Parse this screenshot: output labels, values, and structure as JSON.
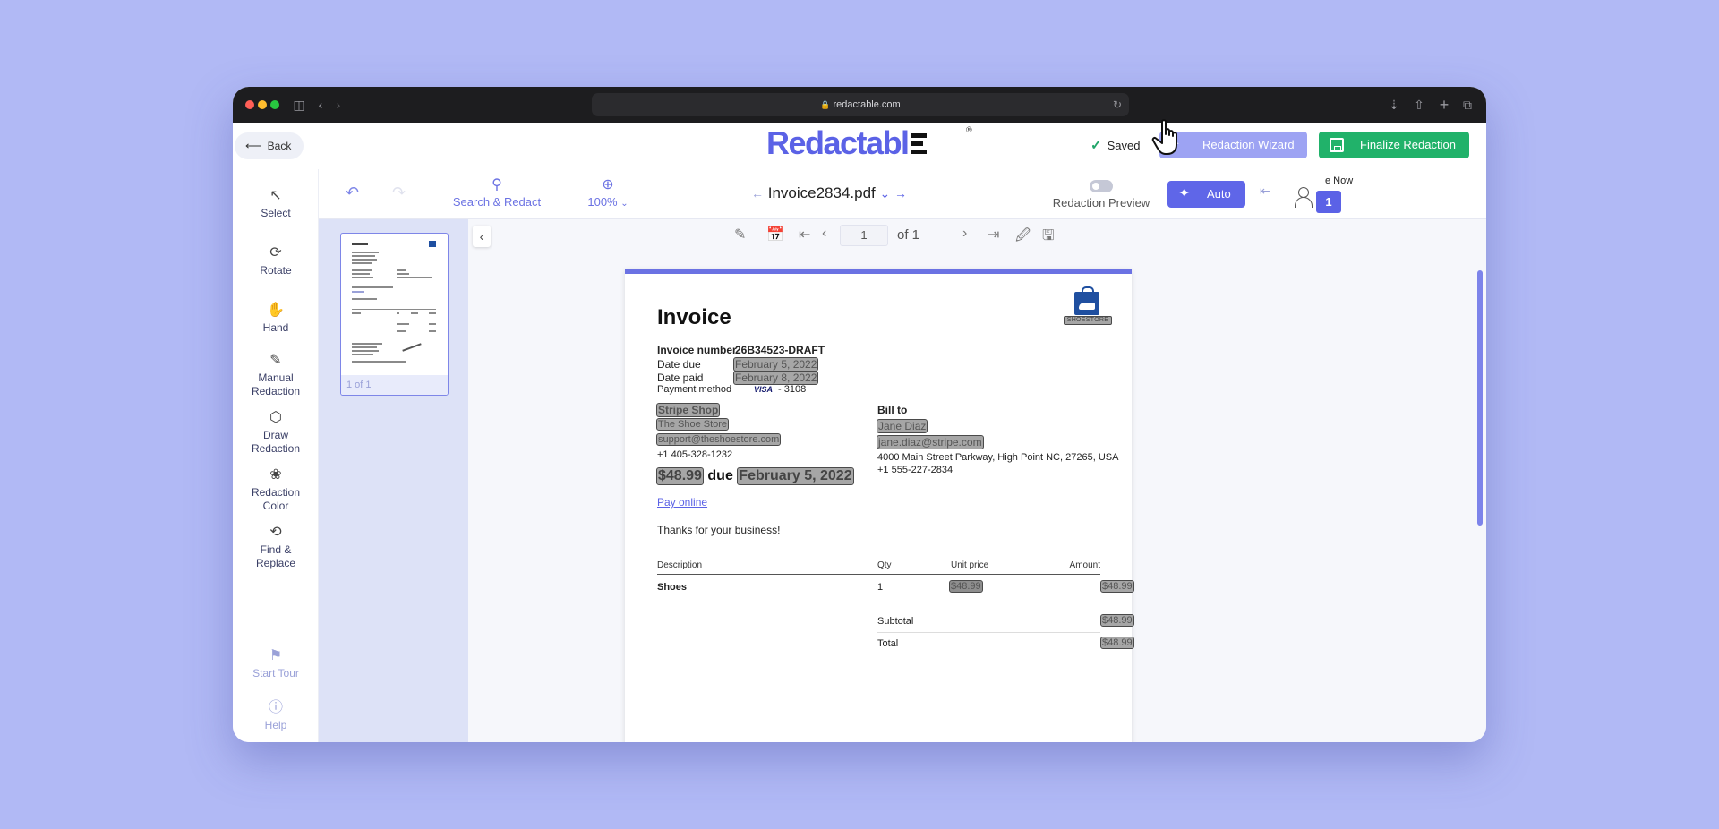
{
  "browser": {
    "url": "redactable.com"
  },
  "header": {
    "back_label": "Back",
    "logo_text": "Redactabl",
    "logo_registered": "®",
    "saved_label": "Saved",
    "wizard_label": "Redaction Wizard",
    "finalize_label": "Finalize Redaction",
    "cta_partial": "e Now"
  },
  "tools": {
    "select": "Select",
    "rotate": "Rotate",
    "hand": "Hand",
    "manual_1": "Manual",
    "manual_2": "Redaction",
    "draw_1": "Draw",
    "draw_2": "Redaction",
    "color_1": "Redaction",
    "color_2": "Color",
    "find_1": "Find &",
    "find_2": "Replace",
    "tour": "Start Tour",
    "help": "Help"
  },
  "toolbar": {
    "search_label": "Search & Redact",
    "zoom_value": "100%",
    "file_name": "Invoice2834.pdf",
    "preview_label": "Redaction Preview",
    "auto_label": "Auto",
    "redaction_count": "1"
  },
  "thumbs": {
    "label": "1 of 1"
  },
  "pager": {
    "current_page": "1",
    "of_label": "of 1"
  },
  "invoice": {
    "title": "Invoice",
    "store_logo_text": "SHOESTORE",
    "invoice_number_label": "Invoice number",
    "invoice_number": "26B34523-DRAFT",
    "date_due_label": "Date due",
    "date_due": "February 5, 2022",
    "date_paid_label": "Date paid",
    "date_paid": "February 8, 2022",
    "payment_method_label": "Payment method",
    "card_brand": "VISA",
    "card_last4": "- 3108",
    "seller_name": "Stripe Shop",
    "seller_store": "The Shoe Store",
    "seller_email": "support@theshoestore.com",
    "seller_phone": "+1 405-328-1232",
    "bill_to_label": "Bill to",
    "customer_name": "Jane Diaz",
    "customer_email": "jane.diaz@stripe.com",
    "customer_address": "4000 Main Street Parkway, High Point NC, 27265, USA",
    "customer_phone": "+1 555-227-2834",
    "amount_due": "$48.99",
    "due_word": "due",
    "due_date": "February 5, 2022",
    "pay_online": "Pay online",
    "thanks": "Thanks for your business!",
    "columns": {
      "description": "Description",
      "qty": "Qty",
      "unit_price": "Unit price",
      "amount": "Amount"
    },
    "item": {
      "description": "Shoes",
      "qty": "1",
      "unit_price": "$48.99",
      "amount": "$48.99"
    },
    "subtotal_label": "Subtotal",
    "subtotal": "$48.99",
    "total_label": "Total",
    "total": "$48.99"
  },
  "colors": {
    "background": "#b1b9f5",
    "brand": "#5b62e6",
    "finalize": "#21b26a",
    "wizard": "#9da3f3",
    "redaction_box": "#a6a6a6"
  }
}
